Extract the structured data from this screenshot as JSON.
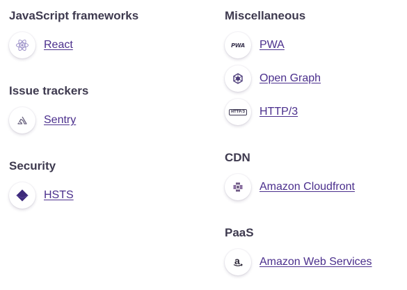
{
  "left": {
    "groups": [
      {
        "title": "JavaScript frameworks",
        "items": [
          {
            "name": "React",
            "icon": "react-icon"
          }
        ]
      },
      {
        "title": "Issue trackers",
        "items": [
          {
            "name": "Sentry",
            "icon": "sentry-icon"
          }
        ]
      },
      {
        "title": "Security",
        "items": [
          {
            "name": "HSTS",
            "icon": "hsts-icon"
          }
        ]
      }
    ]
  },
  "right": {
    "groups": [
      {
        "title": "Miscellaneous",
        "items": [
          {
            "name": "PWA",
            "icon": "pwa-icon",
            "icon_text": "PWA"
          },
          {
            "name": "Open Graph",
            "icon": "open-graph-icon"
          },
          {
            "name": "HTTP/3",
            "icon": "http3-icon",
            "icon_text": "HTTP/3"
          }
        ]
      },
      {
        "title": "CDN",
        "items": [
          {
            "name": "Amazon Cloudfront",
            "icon": "cloudfront-icon"
          }
        ]
      },
      {
        "title": "PaaS",
        "items": [
          {
            "name": "Amazon Web Services",
            "icon": "aws-icon",
            "icon_text": "a"
          }
        ]
      }
    ]
  },
  "colors": {
    "link": "#4a2e8c",
    "heading": "#3e3a4f",
    "icon_purple": "#3d2a7a"
  }
}
